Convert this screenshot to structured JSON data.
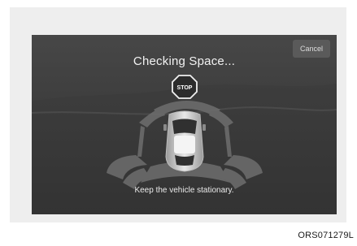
{
  "screen": {
    "title": "Checking Space...",
    "cancel_label": "Cancel",
    "stop_sign_text": "STOP",
    "instruction": "Keep the vehicle stationary."
  },
  "figure": {
    "code": "ORS071279L"
  },
  "colors": {
    "background": "#3a3a3a",
    "sensor_zone": "#6e6e6e",
    "text": "#f2f2f2"
  },
  "icons": [
    "stop-sign-icon",
    "car-top-view-icon"
  ]
}
